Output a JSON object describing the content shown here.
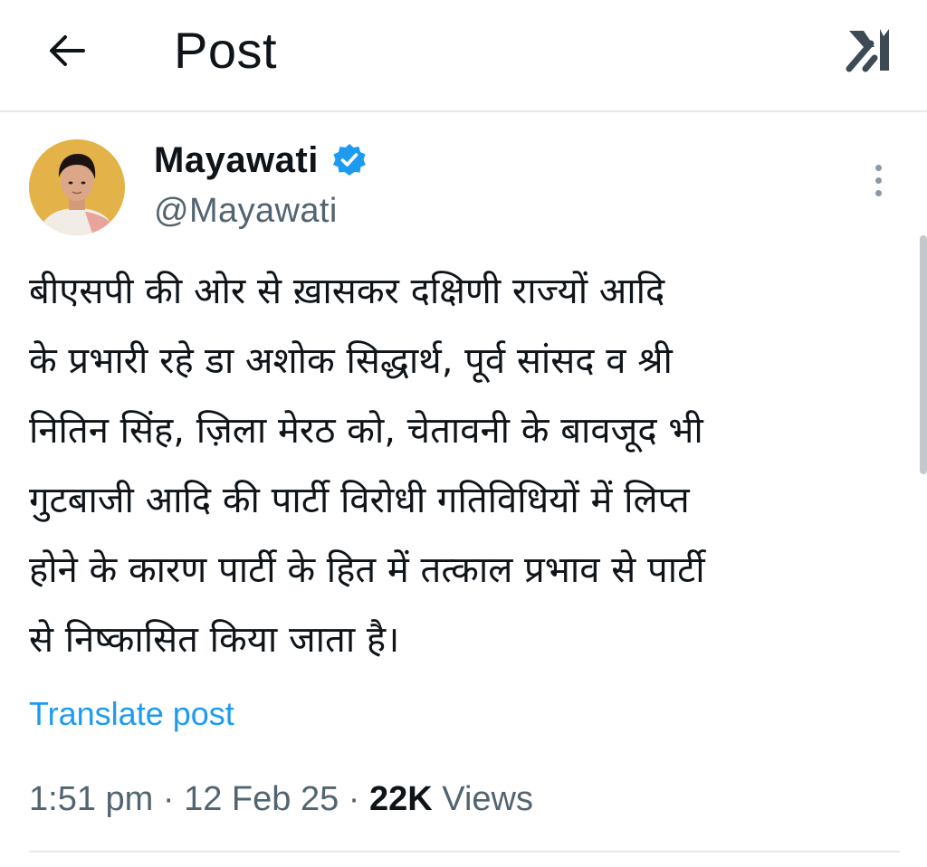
{
  "header": {
    "title": "Post",
    "back_icon": "arrow-left-icon",
    "grok_icon": "grok-icon"
  },
  "author": {
    "name": "Mayawati",
    "handle": "@Mayawati",
    "verified": true,
    "verified_color": "#1d9bf0"
  },
  "post": {
    "lines": [
      "बीएसपी की ओर से ख़ासकर दक्षिणी राज्यों आदि",
      "के प्रभारी रहे डा अशोक सिद्धार्थ, पूर्व सांसद व श्री",
      "नितिन  सिंह, ज़िला मेरठ को, चेतावनी के बावजूद भी",
      "गुटबाजी आदि की पार्टी विरोधी गतिविधियों में लिप्त",
      "होने के कारण पार्टी के हित में तत्काल प्रभाव से पार्टी",
      "से निष्कासित किया जाता है।"
    ],
    "translate_label": "Translate post"
  },
  "meta": {
    "time": "1:51 pm",
    "separator": " · ",
    "date": "12 Feb 25",
    "views_count": "22K",
    "views_label": " Views"
  },
  "colors": {
    "accent": "#1d9bf0",
    "secondary_text": "#536471",
    "divider": "#e7e9ea"
  }
}
